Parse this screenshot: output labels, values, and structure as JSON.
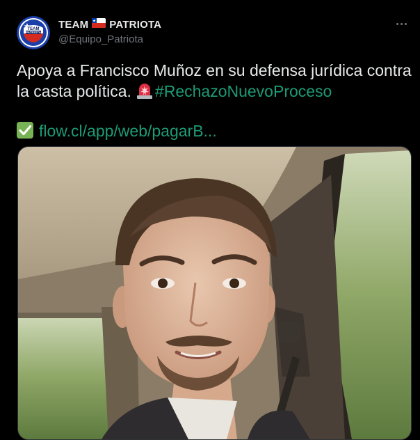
{
  "author": {
    "display_name_before_flag": "TEAM",
    "display_name_after_flag": "PATRIOTA",
    "flag_icon": "chile-flag-icon",
    "handle": "@Equipo_Patriota",
    "avatar_text_top": "TEAM",
    "avatar_text_bottom": "PATRIOTA"
  },
  "tweet": {
    "line1": "Apoya a Francisco Muñoz en su defensa jurídica contra",
    "line2_text": "la casta política.",
    "line2_emoji": "rotating-light-icon",
    "hashtag": "#RechazoNuevoProceso",
    "link_emoji": "check-mark-button-icon",
    "link_text": "flow.cl/app/web/pagarB..."
  },
  "media": {
    "image_subject": "selfie-photo"
  },
  "colors": {
    "background": "#000000",
    "text": "#e7e9ea",
    "secondary": "#71767b",
    "link": "#1d9b75",
    "border": "#2f3336"
  }
}
